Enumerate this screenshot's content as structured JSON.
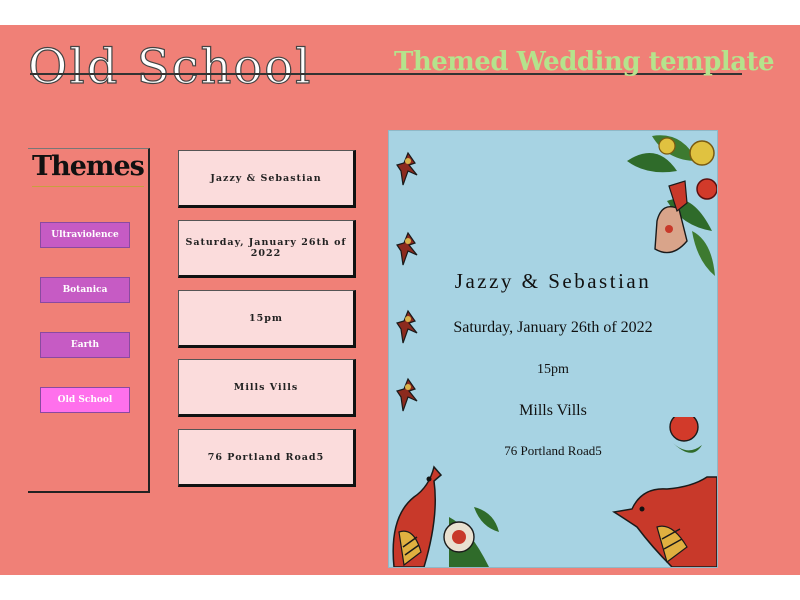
{
  "header": {
    "title": "Old School",
    "subtitle": "Themed Wedding template"
  },
  "themes": {
    "heading": "Themes",
    "items": [
      {
        "label": "Ultraviolence",
        "active": false
      },
      {
        "label": "Botanica",
        "active": false
      },
      {
        "label": "Earth",
        "active": false
      },
      {
        "label": "Old School",
        "active": true
      }
    ]
  },
  "fields": {
    "names": "Jazzy & Sebastian",
    "date": "Saturday, January 26th of 2022",
    "time": "15pm",
    "venue": "Mills Vills",
    "address": "76  Portland Road5"
  },
  "card": {
    "names": "Jazzy & Sebastian",
    "date": "Saturday, January 26th of 2022",
    "time": "15pm",
    "venue": "Mills Vills",
    "address": "76 Portland Road5",
    "decorations": [
      "swallow-tattoo",
      "rose-tattoo",
      "hands-tattoo",
      "songbird-tattoo"
    ]
  },
  "colors": {
    "background": "#f08077",
    "title_fill": "#ffffff",
    "subtitle": "#b5e38c",
    "theme_button": "#c65bc4",
    "theme_button_active": "#ff70ec",
    "field_bg": "#fbdcdc",
    "card_bg": "#a7d3e3"
  }
}
